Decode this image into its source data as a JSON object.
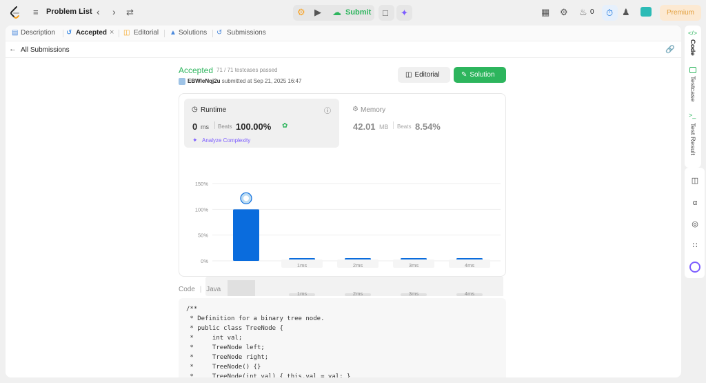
{
  "topbar": {
    "problem_list_label": "Problem List",
    "submit_label": "Submit",
    "streak_count": "0",
    "premium_label": "Premium"
  },
  "tabs": [
    {
      "label": "Description"
    },
    {
      "label": "Accepted"
    },
    {
      "label": "Editorial"
    },
    {
      "label": "Solutions"
    },
    {
      "label": "Submissions"
    }
  ],
  "back_label": "All Submissions",
  "submission": {
    "status": "Accepted",
    "testcases": "71 / 71 testcases passed",
    "username": "EBWleNqj2u",
    "submitted_text": "submitted at Sep 21, 2025 16:47",
    "editorial_button": "Editorial",
    "solution_button": "Solution"
  },
  "runtime": {
    "title": "Runtime",
    "value": "0",
    "unit": "ms",
    "beats_label": "Beats",
    "beats_value": "100.00%",
    "analyze_label": "Analyze Complexity"
  },
  "memory": {
    "title": "Memory",
    "value": "42.01",
    "unit": "MB",
    "beats_label": "Beats",
    "beats_value": "8.54%"
  },
  "chart_data": {
    "type": "bar",
    "categories": [
      "0ms",
      "1ms",
      "2ms",
      "3ms",
      "4ms"
    ],
    "values": [
      100,
      2,
      2,
      2,
      2
    ],
    "y_ticks": [
      "150%",
      "100%",
      "50%",
      "0%"
    ],
    "ylim": [
      0,
      150
    ],
    "highlight_index": 0,
    "accent": "#0a6cdd"
  },
  "code": {
    "label": "Code",
    "language": "Java",
    "lines": [
      "/**",
      " * Definition for a binary tree node.",
      " * public class TreeNode {",
      " *     int val;",
      " *     TreeNode left;",
      " *     TreeNode right;",
      " *     TreeNode() {}",
      " *     TreeNode(int val) { this.val = val; }"
    ]
  },
  "right_sidebar": {
    "tabs": [
      "Code",
      "Testcase",
      "Test Result"
    ]
  }
}
